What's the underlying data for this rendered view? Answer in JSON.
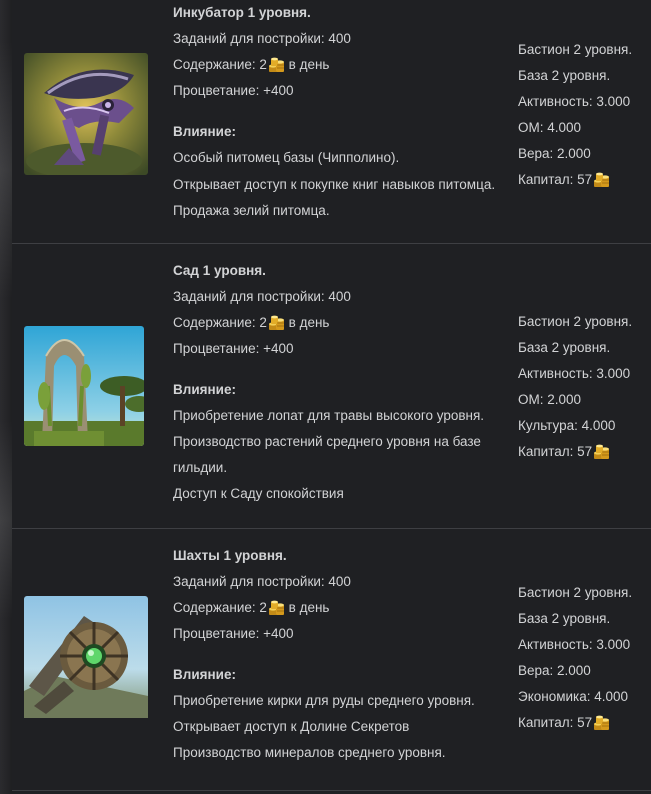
{
  "currency_icon": "gold-coins-icon",
  "colors": {
    "background": "#1f2023",
    "text": "#d2d3d5",
    "divider": "#3e3f43",
    "coin_gold": "#e8b52b"
  },
  "buildings": [
    {
      "image_icon": "incubator-image",
      "title": "Инкубатор 1 уровня.",
      "tasks": "Заданий для постройки: 400",
      "upkeep_prefix": "Содержание: 2",
      "upkeep_suffix": " в день",
      "prosperity": "Процветание: +400",
      "influence_label": "Влияние:",
      "effects": [
        "Особый питомец базы (Чипполино).",
        "Открывает доступ к покупке книг навыков питомца.",
        "Продажа зелий питомца."
      ],
      "requirements": [
        "Бастион 2 уровня.",
        "База 2 уровня.",
        "Активность: 3.000",
        "ОМ: 4.000",
        "Вера: 2.000"
      ],
      "capital": "Капитал: 57"
    },
    {
      "image_icon": "garden-image",
      "title": "Сад 1 уровня.",
      "tasks": "Заданий для постройки: 400",
      "upkeep_prefix": "Содержание: 2",
      "upkeep_suffix": " в день",
      "prosperity": "Процветание: +400",
      "influence_label": "Влияние:",
      "effects": [
        "Приобретение лопат для травы высокого уровня.",
        "Производство растений среднего уровня на базе",
        "гильдии.",
        "Доступ к Саду спокойствия"
      ],
      "requirements": [
        "Бастион 2 уровня.",
        "База 2 уровня.",
        "Активность: 3.000",
        "ОМ: 2.000",
        "Культура: 4.000"
      ],
      "capital": "Капитал: 57"
    },
    {
      "image_icon": "mines-image",
      "title": "Шахты 1 уровня.",
      "tasks": "Заданий для постройки: 400",
      "upkeep_prefix": "Содержание: 2",
      "upkeep_suffix": " в день",
      "prosperity": "Процветание: +400",
      "influence_label": "Влияние:",
      "effects": [
        "Приобретение кирки для руды среднего уровня.",
        "Открывает доступ к Долине Секретов",
        "Производство минералов среднего уровня."
      ],
      "requirements": [
        "Бастион 2 уровня.",
        "База 2 уровня.",
        "Активность: 3.000",
        "Вера: 2.000",
        "Экономика: 4.000"
      ],
      "capital": "Капитал: 57"
    }
  ]
}
